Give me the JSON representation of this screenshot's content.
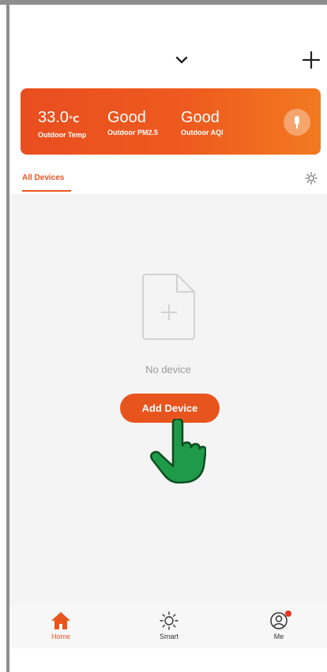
{
  "colors": {
    "accent": "#e8541e",
    "card_start": "#e94e1f",
    "card_end": "#f27a20",
    "badge": "#e8341e"
  },
  "header": {
    "home_selector_icon": "chevron-down-icon",
    "add_icon": "plus-icon"
  },
  "weather": {
    "temp_value": "33.0",
    "temp_unit": "℃",
    "temp_label": "Outdoor Temp",
    "pm25_value": "Good",
    "pm25_label": "Outdoor PM2.5",
    "aqi_value": "Good",
    "aqi_label": "Outdoor AQI",
    "mic_icon": "microphone-icon"
  },
  "tabs": {
    "all_devices": "All Devices",
    "settings_icon": "gear-icon"
  },
  "empty_state": {
    "icon": "add-file-icon",
    "text": "No device",
    "button_label": "Add Device"
  },
  "nav": [
    {
      "label": "Home",
      "icon": "home-icon"
    },
    {
      "label": "Smart",
      "icon": "sun-icon"
    },
    {
      "label": "Me",
      "icon": "user-icon"
    }
  ]
}
